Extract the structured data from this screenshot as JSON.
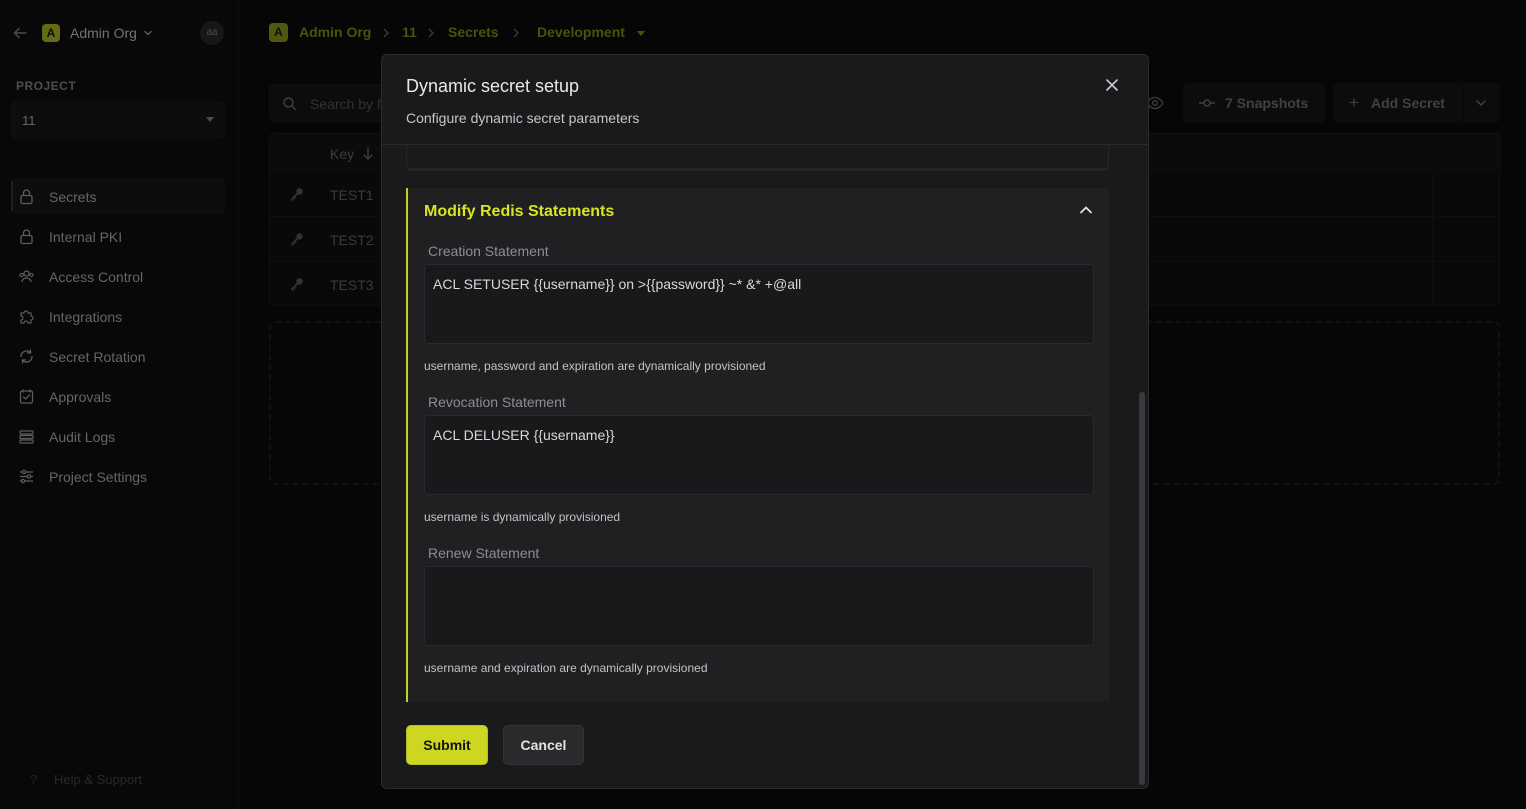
{
  "sidebar": {
    "org_name": "Admin Org",
    "org_initial": "A",
    "avatar_initials": "aa",
    "project_label": "PROJECT",
    "project_value": "11",
    "nav": [
      {
        "label": "Secrets",
        "icon": "lock-icon",
        "active": true
      },
      {
        "label": "Internal PKI",
        "icon": "lock-icon"
      },
      {
        "label": "Access Control",
        "icon": "users-icon"
      },
      {
        "label": "Integrations",
        "icon": "puzzle-icon"
      },
      {
        "label": "Secret Rotation",
        "icon": "rotate-icon"
      },
      {
        "label": "Approvals",
        "icon": "check-square-icon"
      },
      {
        "label": "Audit Logs",
        "icon": "list-icon"
      },
      {
        "label": "Project Settings",
        "icon": "sliders-icon"
      }
    ],
    "help_label": "Help & Support"
  },
  "breadcrumb": {
    "initial": "A",
    "org": "Admin Org",
    "project": "11",
    "section": "Secrets",
    "environment": "Development"
  },
  "toolbar": {
    "search_placeholder": "Search by folder name, key name, comment...",
    "snapshots_label": "7 Snapshots",
    "add_secret_label": "Add Secret"
  },
  "table": {
    "key_header": "Key",
    "rows": [
      "TEST1",
      "TEST2",
      "TEST3"
    ]
  },
  "modal": {
    "title": "Dynamic secret setup",
    "subtitle": "Configure dynamic secret parameters",
    "accordion_title": "Modify Redis Statements",
    "fields": [
      {
        "label": "Creation Statement",
        "value": "ACL SETUSER {{username}} on >{{password}} ~* &* +@all",
        "helper": "username, password and expiration are dynamically provisioned"
      },
      {
        "label": "Revocation Statement",
        "value": "ACL DELUSER {{username}}",
        "helper": "username is dynamically provisioned"
      },
      {
        "label": "Renew Statement",
        "value": "",
        "helper": "username and expiration are dynamically provisioned"
      }
    ],
    "submit_label": "Submit",
    "cancel_label": "Cancel"
  },
  "colors": {
    "accent": "#cdd722",
    "accent_text": "#d9e422",
    "background": "#0b0b0c",
    "modal_bg": "#1a1a1c"
  }
}
